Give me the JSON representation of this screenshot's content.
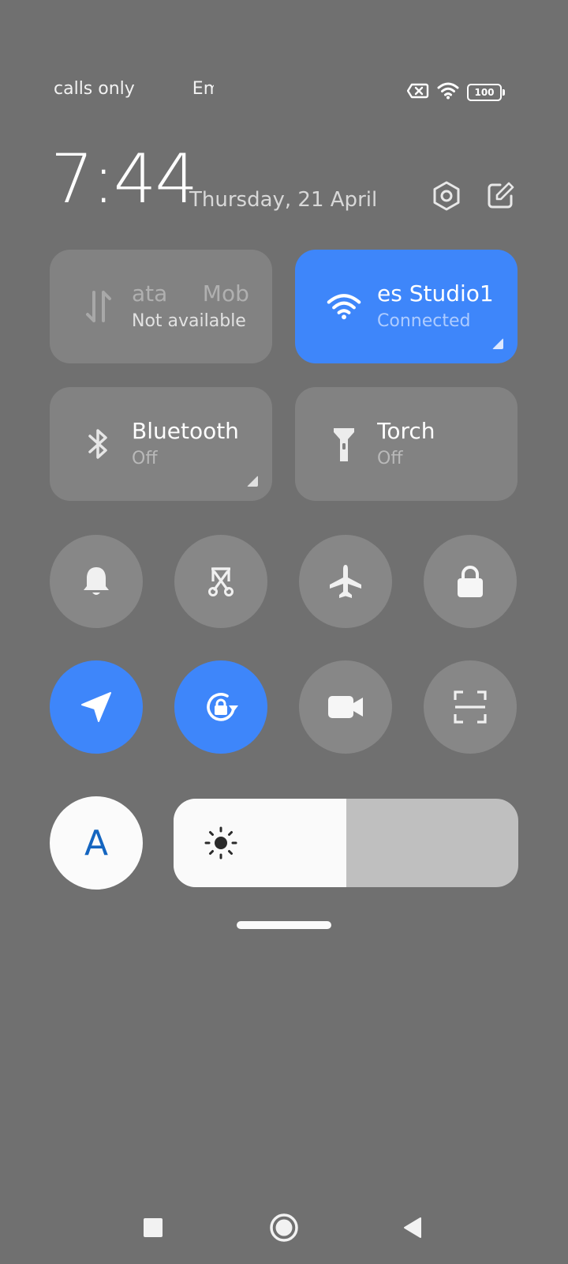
{
  "status_bar": {
    "carrier_1": "calls only",
    "carrier_2": "Em",
    "battery_level": "100"
  },
  "header": {
    "time": "7:44",
    "date": "Thursday, 21 April"
  },
  "tiles": {
    "mobile_data": {
      "title": "ata     Mob",
      "subtitle": "Not available",
      "state": "unavailable"
    },
    "wifi": {
      "title": "es Studio1",
      "subtitle": "Connected",
      "state": "on"
    },
    "bluetooth": {
      "title": "Bluetooth",
      "subtitle": "Off",
      "state": "off"
    },
    "torch": {
      "title": "Torch",
      "subtitle": "Off",
      "state": "off"
    }
  },
  "toggles": [
    {
      "name": "sound",
      "icon": "bell-icon",
      "active": false
    },
    {
      "name": "screenshot",
      "icon": "screenshot-scissors-icon",
      "active": false
    },
    {
      "name": "airplane-mode",
      "icon": "airplane-icon",
      "active": false
    },
    {
      "name": "lock-screen",
      "icon": "lock-icon",
      "active": false
    },
    {
      "name": "location",
      "icon": "location-arrow-icon",
      "active": true
    },
    {
      "name": "auto-rotate",
      "icon": "rotation-lock-icon",
      "active": true
    },
    {
      "name": "screen-recorder",
      "icon": "video-camera-icon",
      "active": false
    },
    {
      "name": "scanner",
      "icon": "scan-frame-icon",
      "active": false
    }
  ],
  "auto_brightness": {
    "label": "A"
  },
  "brightness": {
    "level": 0.5
  },
  "colors": {
    "background": "#707070",
    "tile": "#828282",
    "round_button": "#878787",
    "accent": "#3e86fa"
  }
}
